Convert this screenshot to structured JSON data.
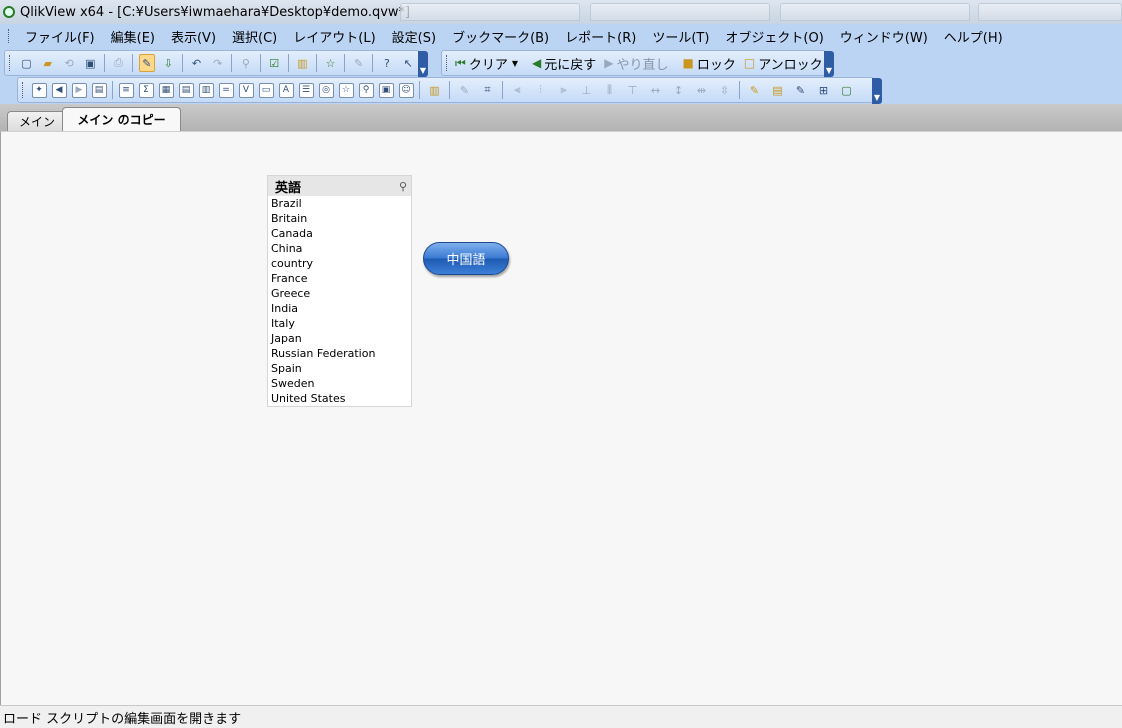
{
  "window": {
    "title": "QlikView x64 - [C:¥Users¥iwmaehara¥Desktop¥demo.qvw*]"
  },
  "menubar": {
    "items": [
      {
        "label": "ファイル(F)"
      },
      {
        "label": "編集(E)"
      },
      {
        "label": "表示(V)"
      },
      {
        "label": "選択(C)"
      },
      {
        "label": "レイアウト(L)"
      },
      {
        "label": "設定(S)"
      },
      {
        "label": "ブックマーク(B)"
      },
      {
        "label": "レポート(R)"
      },
      {
        "label": "ツール(T)"
      },
      {
        "label": "オブジェクト(O)"
      },
      {
        "label": "ウィンドウ(W)"
      },
      {
        "label": "ヘルプ(H)"
      }
    ]
  },
  "navigation_toolbar": {
    "clear_label": "クリア",
    "back_label": "元に戻す",
    "redo_label": "やり直し",
    "lock_label": "ロック",
    "unlock_label": "アンロック"
  },
  "sheet_tabs": [
    {
      "label": "メイン"
    },
    {
      "label": "メイン のコピー"
    }
  ],
  "listbox": {
    "title": "英語",
    "items": [
      "Brazil",
      "Britain",
      "Canada",
      "China",
      "country",
      "France",
      "Greece",
      "India",
      "Italy",
      "Japan",
      "Russian Federation",
      "Spain",
      "Sweden",
      "United States"
    ]
  },
  "button_object": {
    "label": "中国語"
  },
  "statusbar": {
    "text": "ロード スクリプトの編集画面を開きます"
  },
  "colors": {
    "toolbar_bg": "#bcd4f3",
    "button_blue": "#3b7bd3",
    "sheet_bg": "#f7f7f7"
  }
}
